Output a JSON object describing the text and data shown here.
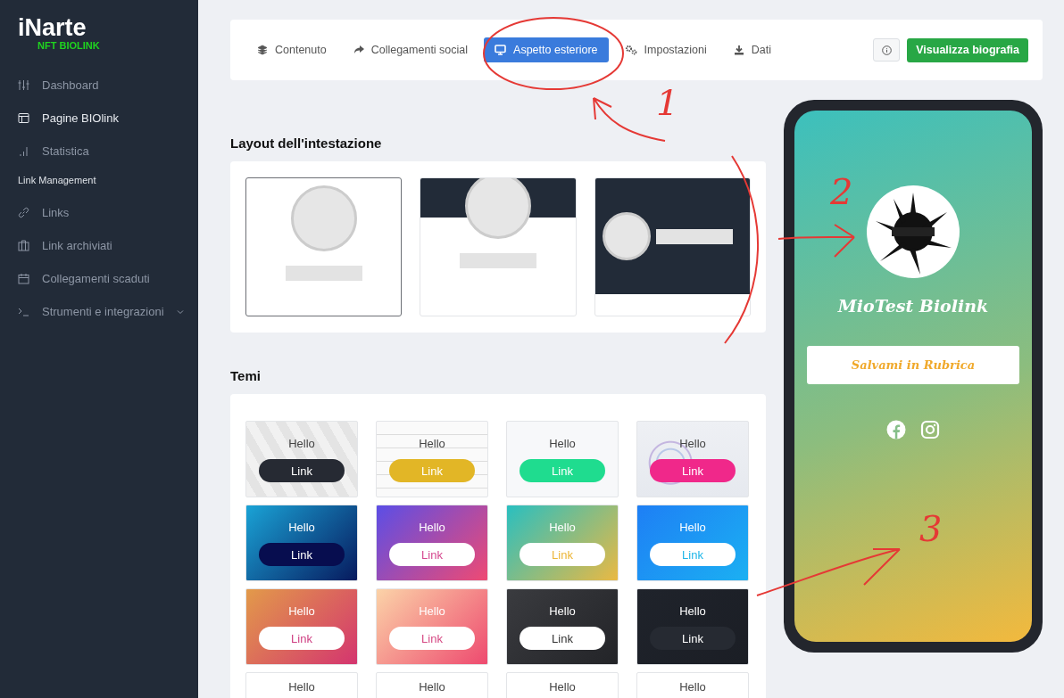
{
  "brand": {
    "name": "iNarte",
    "tagline": "NFT BIOLINK"
  },
  "sidebar": {
    "items": [
      {
        "kind": "sliders",
        "label": "Dashboard",
        "selected": false
      },
      {
        "kind": "layout",
        "label": "Pagine BIOlink",
        "selected": true
      },
      {
        "kind": "chart",
        "label": "Statistica",
        "selected": false
      }
    ],
    "section": "Link Management",
    "links": [
      {
        "kind": "link",
        "label": "Links",
        "selected": false
      },
      {
        "kind": "archive",
        "label": "Link archiviati",
        "selected": false
      },
      {
        "kind": "calendar",
        "label": "Collegamenti scaduti",
        "selected": false
      },
      {
        "kind": "terminal",
        "label": "Strumenti e integrazioni",
        "selected": false,
        "expanded": false
      }
    ]
  },
  "tabs": [
    {
      "kind": "layers",
      "label": "Contenuto",
      "selected": false
    },
    {
      "kind": "share",
      "label": "Collegamenti social",
      "selected": false
    },
    {
      "kind": "monitor",
      "label": "Aspetto esteriore",
      "selected": true
    },
    {
      "kind": "gears",
      "label": "Impostazioni",
      "selected": false
    },
    {
      "kind": "download",
      "label": "Dati",
      "selected": false
    }
  ],
  "view_button": "Visualizza biografia",
  "header_layout": {
    "title": "Layout dell'intestazione",
    "options": [
      {
        "kind": "centered",
        "selected": true
      },
      {
        "kind": "banner",
        "selected": false
      },
      {
        "kind": "side",
        "selected": false
      }
    ]
  },
  "themes": {
    "title": "Temi",
    "items": [
      {
        "kind": "cubes",
        "hello": "Hello",
        "link": "Link"
      },
      {
        "kind": "lines",
        "hello": "Hello",
        "link": "Link"
      },
      {
        "kind": "plain",
        "hello": "Hello",
        "link": "Link"
      },
      {
        "kind": "rings",
        "hello": "Hello",
        "link": "Link"
      },
      {
        "kind": "ocean",
        "hello": "Hello",
        "link": "Link"
      },
      {
        "kind": "violet",
        "hello": "Hello",
        "link": "Link"
      },
      {
        "kind": "meadow",
        "hello": "Hello",
        "link": "Link"
      },
      {
        "kind": "sky",
        "hello": "Hello",
        "link": "Link"
      },
      {
        "kind": "sunset",
        "hello": "Hello",
        "link": "Link"
      },
      {
        "kind": "peach",
        "hello": "Hello",
        "link": "Link"
      },
      {
        "kind": "graphite",
        "hello": "Hello",
        "link": "Link"
      },
      {
        "kind": "midnight",
        "hello": "Hello",
        "link": "Link"
      },
      {
        "kind": "blank",
        "hello": "Hello"
      },
      {
        "kind": "blank",
        "hello": "Hello"
      },
      {
        "kind": "blank",
        "hello": "Hello"
      },
      {
        "kind": "blank",
        "hello": "Hello"
      }
    ]
  },
  "preview": {
    "name": "MioTest Biolink",
    "button": "Salvami in Rubrica",
    "socials": [
      {
        "kind": "facebook"
      },
      {
        "kind": "instagram"
      }
    ]
  },
  "annotations": [
    {
      "label": "1"
    },
    {
      "label": "2"
    },
    {
      "label": "3"
    }
  ]
}
